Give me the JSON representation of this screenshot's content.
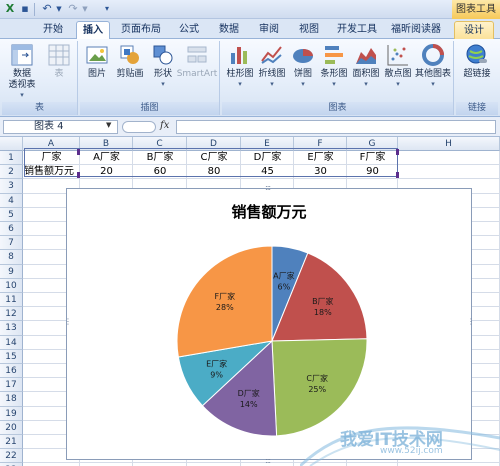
{
  "titlebar": {
    "context_tools": "图表工具"
  },
  "tabs": [
    "开始",
    "插入",
    "页面布局",
    "公式",
    "数据",
    "审阅",
    "视图",
    "开发工具",
    "福昕阅读器",
    "设计"
  ],
  "ribbon": {
    "groups": {
      "table": {
        "label": "表",
        "buttons": [
          "数据\n透视表",
          "表"
        ]
      },
      "illustrations": {
        "label": "插图",
        "buttons": [
          "图片",
          "剪贴画",
          "形状",
          "SmartArt"
        ]
      },
      "charts": {
        "label": "图表",
        "buttons": [
          "柱形图",
          "折线图",
          "饼图",
          "条形图",
          "面积图",
          "散点图",
          "其他图表"
        ]
      },
      "links": {
        "label": "链接",
        "buttons": [
          "超链接"
        ]
      }
    }
  },
  "formula_bar": {
    "name_box": "图表 4",
    "fx": "fx",
    "formula": ""
  },
  "sheet": {
    "columns": [
      "A",
      "B",
      "C",
      "D",
      "E",
      "F",
      "G",
      "H"
    ],
    "rows": [
      "1",
      "2",
      "3",
      "4",
      "5",
      "6",
      "7",
      "8",
      "9",
      "10",
      "11",
      "12",
      "13",
      "14",
      "15",
      "16",
      "17",
      "18",
      "19",
      "20",
      "21",
      "22",
      "23"
    ],
    "cells": {
      "row1": [
        "厂家",
        "A厂家",
        "B厂家",
        "C厂家",
        "D厂家",
        "E厂家",
        "F厂家"
      ],
      "row2": [
        "销售额万元",
        "20",
        "60",
        "80",
        "45",
        "30",
        "90"
      ]
    }
  },
  "chart_data": {
    "type": "pie",
    "title": "销售额万元",
    "categories": [
      "A厂家",
      "B厂家",
      "C厂家",
      "D厂家",
      "E厂家",
      "F厂家"
    ],
    "values": [
      20,
      60,
      80,
      45,
      30,
      90
    ],
    "data_labels": [
      "6%",
      "18%",
      "25%",
      "14%",
      "9%",
      "28%"
    ],
    "colors": [
      "#4f81bd",
      "#c0504d",
      "#9bbb59",
      "#8064a2",
      "#4bacc6",
      "#f79646"
    ]
  },
  "watermark": {
    "text": "我爱IT技术网",
    "url": "www.52ij.com"
  }
}
